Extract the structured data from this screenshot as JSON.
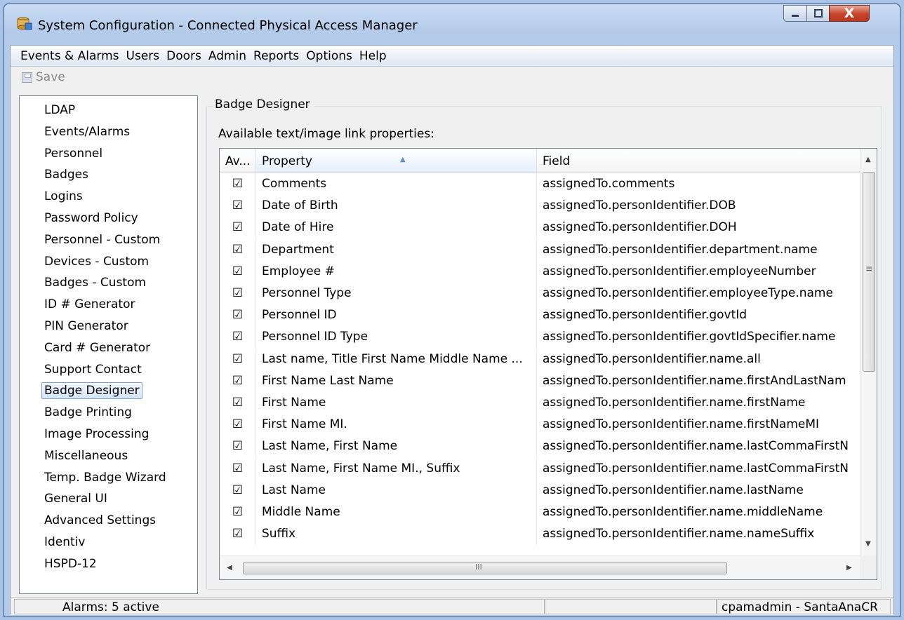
{
  "window": {
    "title": "System Configuration - Connected Physical Access Manager",
    "icon": "database-icon",
    "controls": {
      "close": "X"
    }
  },
  "menu": [
    "Events & Alarms",
    "Users",
    "Doors",
    "Admin",
    "Reports",
    "Options",
    "Help"
  ],
  "toolbar": {
    "save_label": "Save"
  },
  "nav": {
    "items": [
      "LDAP",
      "Events/Alarms",
      "Personnel",
      "Badges",
      "Logins",
      "Password Policy",
      "Personnel - Custom",
      "Devices - Custom",
      "Badges - Custom",
      "ID # Generator",
      "PIN Generator",
      "Card # Generator",
      "Support Contact",
      "Badge Designer",
      "Badge Printing",
      "Image Processing",
      "Miscellaneous",
      "Temp. Badge Wizard",
      "General UI",
      "Advanced Settings",
      "Identiv",
      "HSPD-12"
    ],
    "selected": "Badge Designer"
  },
  "panel": {
    "title": "Badge Designer",
    "label": "Available text/image link properties:"
  },
  "grid": {
    "columns": {
      "avail": "Av...",
      "property": "Property",
      "field": "Field"
    },
    "sort_column": "Property",
    "rows": [
      {
        "checked": true,
        "property": "Comments",
        "field": "assignedTo.comments"
      },
      {
        "checked": true,
        "property": "Date of Birth",
        "field": "assignedTo.personIdentifier.DOB"
      },
      {
        "checked": true,
        "property": "Date of Hire",
        "field": "assignedTo.personIdentifier.DOH"
      },
      {
        "checked": true,
        "property": "Department",
        "field": "assignedTo.personIdentifier.department.name"
      },
      {
        "checked": true,
        "property": "Employee #",
        "field": "assignedTo.personIdentifier.employeeNumber"
      },
      {
        "checked": true,
        "property": "Personnel Type",
        "field": "assignedTo.personIdentifier.employeeType.name"
      },
      {
        "checked": true,
        "property": "Personnel ID",
        "field": "assignedTo.personIdentifier.govtId"
      },
      {
        "checked": true,
        "property": "Personnel ID Type",
        "field": "assignedTo.personIdentifier.govtIdSpecifier.name"
      },
      {
        "checked": true,
        "property": "Last name, Title First Name Middle Name ...",
        "field": "assignedTo.personIdentifier.name.all"
      },
      {
        "checked": true,
        "property": "First Name Last Name",
        "field": "assignedTo.personIdentifier.name.firstAndLastNam"
      },
      {
        "checked": true,
        "property": "First Name",
        "field": "assignedTo.personIdentifier.name.firstName"
      },
      {
        "checked": true,
        "property": "First Name MI.",
        "field": "assignedTo.personIdentifier.name.firstNameMI"
      },
      {
        "checked": true,
        "property": "Last Name, First Name",
        "field": "assignedTo.personIdentifier.name.lastCommaFirstN"
      },
      {
        "checked": true,
        "property": "Last Name, First Name MI., Suffix",
        "field": "assignedTo.personIdentifier.name.lastCommaFirstN"
      },
      {
        "checked": true,
        "property": "Last Name",
        "field": "assignedTo.personIdentifier.name.lastName"
      },
      {
        "checked": true,
        "property": "Middle Name",
        "field": "assignedTo.personIdentifier.name.middleName"
      },
      {
        "checked": true,
        "property": "Suffix",
        "field": "assignedTo.personIdentifier.name.nameSuffix"
      }
    ]
  },
  "status": {
    "alarms": "Alarms: 5 active",
    "middle": "",
    "user": "cpamadmin - SantaAnaCR"
  },
  "colors": {
    "selection_border": "#7da2ce",
    "close_button": "#c9432a"
  }
}
